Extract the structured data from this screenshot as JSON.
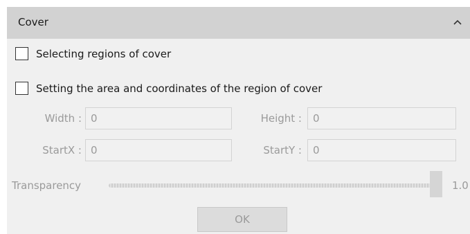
{
  "section": {
    "title": "Cover"
  },
  "options": {
    "select_regions_label": "Selecting regions of cover",
    "set_area_label": "Setting the area and coordinates of the region of cover"
  },
  "fields": {
    "width_label": "Width :",
    "width_value": "0",
    "height_label": "Height :",
    "height_value": "0",
    "startx_label": "StartX :",
    "startx_value": "0",
    "starty_label": "StartY :",
    "starty_value": "0"
  },
  "transparency": {
    "label": "Transparency",
    "value": "1.0"
  },
  "buttons": {
    "ok": "OK"
  },
  "colors": {
    "header_bg": "#d2d2d2",
    "panel_bg": "#f0f0f0",
    "disabled_text": "#9a9a9a"
  }
}
